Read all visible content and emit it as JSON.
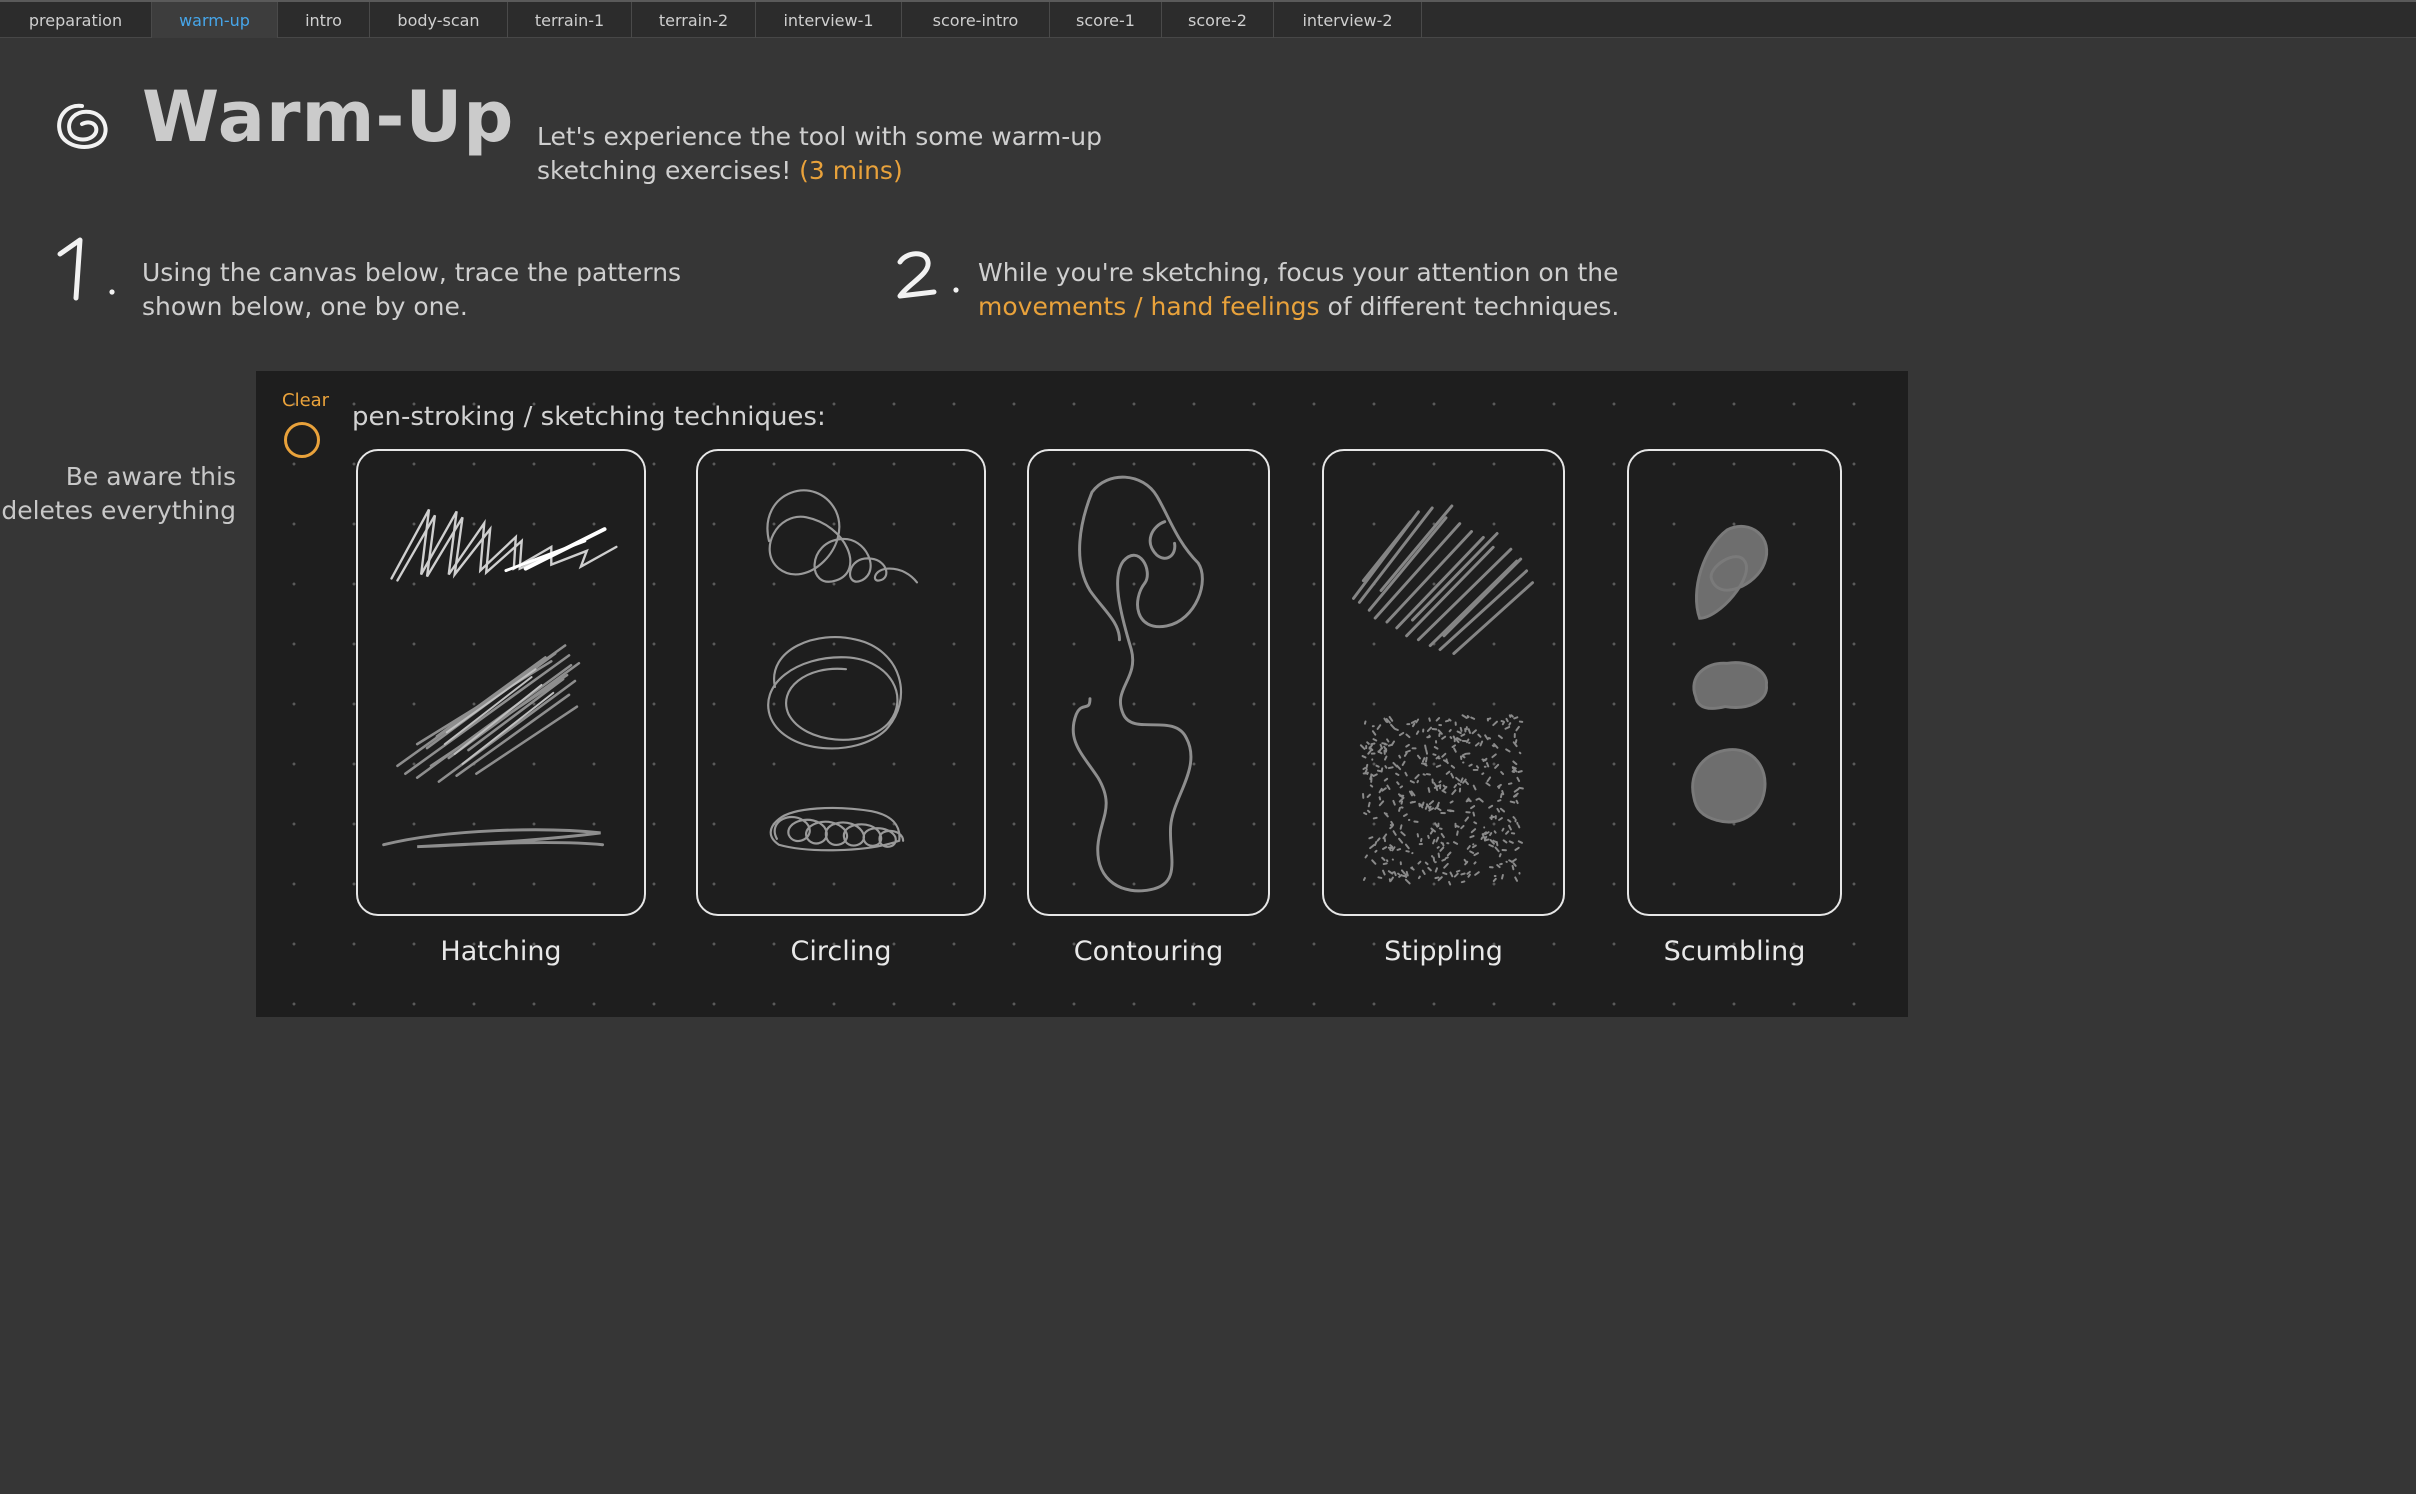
{
  "tabs": [
    {
      "label": "preparation",
      "active": false
    },
    {
      "label": "warm-up",
      "active": true
    },
    {
      "label": "intro",
      "active": false
    },
    {
      "label": "body-scan",
      "active": false
    },
    {
      "label": "terrain-1",
      "active": false
    },
    {
      "label": "terrain-2",
      "active": false
    },
    {
      "label": "interview-1",
      "active": false
    },
    {
      "label": "score-intro",
      "active": false
    },
    {
      "label": "score-1",
      "active": false
    },
    {
      "label": "score-2",
      "active": false
    },
    {
      "label": "interview-2",
      "active": false
    }
  ],
  "header": {
    "title": "Warm-Up",
    "intro": "Let's experience the tool with some warm-up sketching exercises!",
    "duration": "(3 mins)"
  },
  "steps": [
    {
      "number": "1.",
      "text": "Using the canvas below, trace the patterns shown below, one by one."
    },
    {
      "number": "2.",
      "text_before": "While you're sketching, focus your attention on the",
      "highlight": "movements / hand feelings",
      "text_after": "of different techniques."
    }
  ],
  "side_note": "Be aware this deletes everything",
  "canvas": {
    "clear_label": "Clear",
    "heading": "pen-stroking / sketching techniques:",
    "techniques": [
      {
        "label": "Hatching",
        "icon": "hatching-pattern-icon"
      },
      {
        "label": "Circling",
        "icon": "circling-pattern-icon"
      },
      {
        "label": "Contouring",
        "icon": "contouring-pattern-icon"
      },
      {
        "label": "Stippling",
        "icon": "stippling-pattern-icon"
      },
      {
        "label": "Scumbling",
        "icon": "scumbling-pattern-icon"
      }
    ]
  },
  "colors": {
    "background": "#363636",
    "canvas": "#1e1e1e",
    "accent": "#e9a23b",
    "active_tab_text": "#46a6ea"
  }
}
